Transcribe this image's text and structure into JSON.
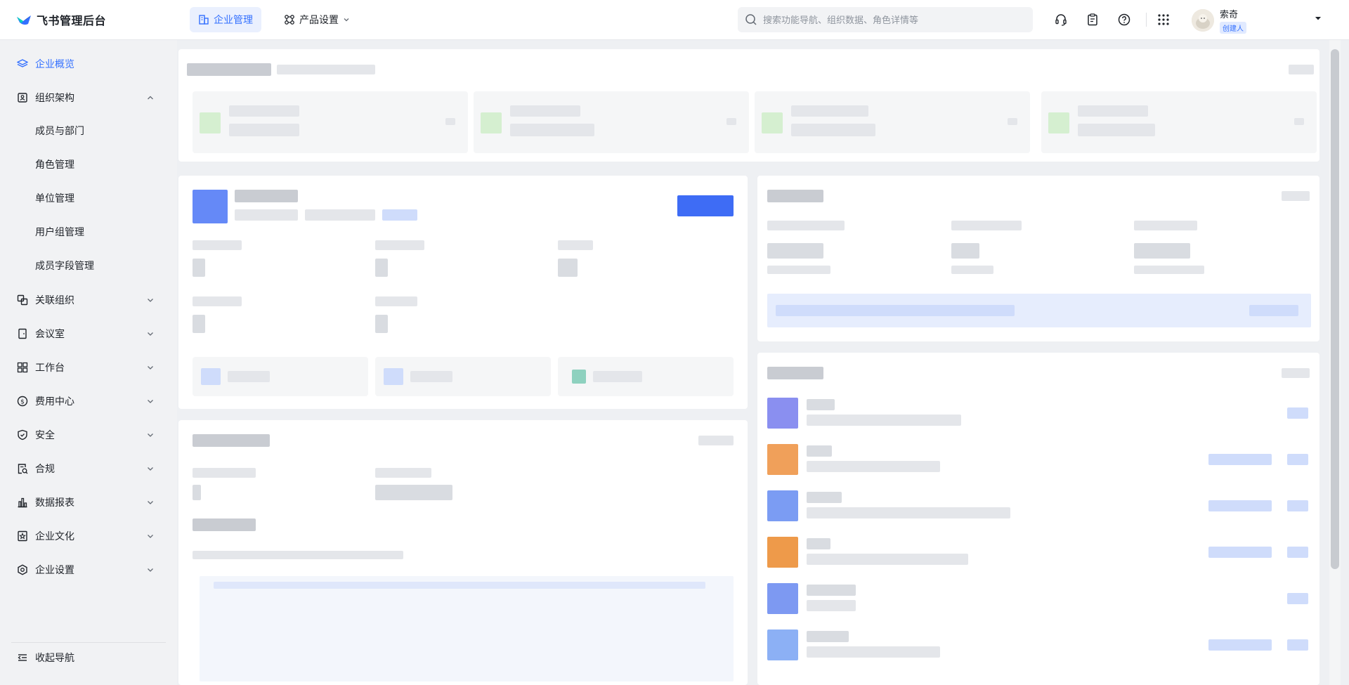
{
  "app": {
    "name": "飞书管理后台"
  },
  "topnav": {
    "tabs": [
      {
        "label": "企业管理",
        "active": true
      },
      {
        "label": "产品设置",
        "active": false
      }
    ]
  },
  "search": {
    "placeholder": "搜索功能导航、组织数据、角色详情等"
  },
  "user": {
    "name": "索奇",
    "role": "创建人"
  },
  "sidebar": {
    "items": [
      {
        "label": "企业概览",
        "icon": "layers-icon",
        "active": true
      },
      {
        "label": "组织架构",
        "icon": "org-icon",
        "expanded": true,
        "children": [
          "成员与部门",
          "角色管理",
          "单位管理",
          "用户组管理",
          "成员字段管理"
        ]
      },
      {
        "label": "关联组织",
        "icon": "link-org-icon"
      },
      {
        "label": "会议室",
        "icon": "door-icon"
      },
      {
        "label": "工作台",
        "icon": "grid-icon"
      },
      {
        "label": "费用中心",
        "icon": "dollar-icon"
      },
      {
        "label": "安全",
        "icon": "shield-icon"
      },
      {
        "label": "合规",
        "icon": "compliance-icon"
      },
      {
        "label": "数据报表",
        "icon": "bar-chart-icon"
      },
      {
        "label": "企业文化",
        "icon": "culture-icon"
      },
      {
        "label": "企业设置",
        "icon": "settings-icon"
      }
    ],
    "collapse_label": "收起导航"
  },
  "colors": {
    "accent": "#3370ff",
    "sidebar_bg": "#f1f2f4",
    "page_bg": "#eef0f3"
  }
}
